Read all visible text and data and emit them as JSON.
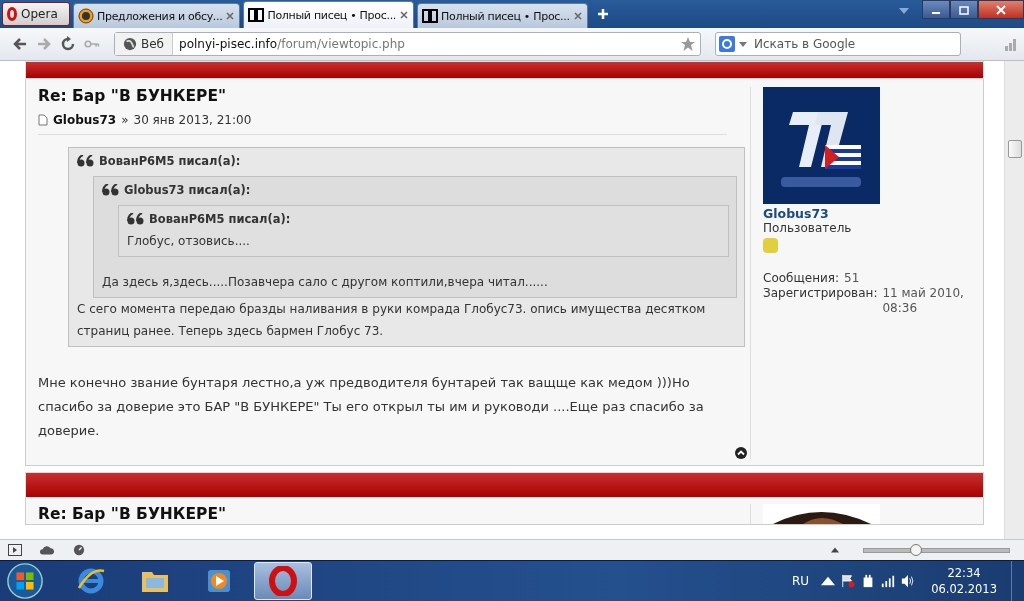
{
  "browser": {
    "menu_label": "Opera",
    "tabs": [
      {
        "label": "Предложения и обсу...",
        "selected": false,
        "kind": "globe"
      },
      {
        "label": "Полный писец • Прос...",
        "selected": true,
        "kind": "forum"
      },
      {
        "label": "Полный писец • Прос...",
        "selected": false,
        "kind": "forum"
      }
    ],
    "address": {
      "badge": "Веб",
      "host": "polnyi-pisec.info",
      "path": "/forum/viewtopic.php"
    },
    "search": {
      "placeholder": "Искать в Google"
    }
  },
  "post": {
    "title": "Re: Бар \"В БУНКЕРЕ\"",
    "author": "Globus73",
    "separator": "»",
    "date": "30 янв 2013, 21:00",
    "quote": {
      "header": "ВованР6М5 писал(а):",
      "text": "С сего момента передаю бразды наливания в руки комрада Глобус73. опись имущества десятком страниц ранее. Теперь здесь бармен Глобус 73.",
      "quote": {
        "header": "Globus73 писал(а):",
        "text": "Да здесь я,здесь.....Позавчера сало с другом коптили,вчера читал......",
        "quote": {
          "header": "ВованР6М5 писал(а):",
          "text": "Глобус, отзовись...."
        }
      }
    },
    "text": "Мне конечно звание бунтаря лестно,а уж предводителя бунтарей так ващще как медом )))Но спасибо за доверие это БАР \"В БУНКЕРЕ\" Ты его открыл ты им и руководи ....Еще раз спасибо за доверие.",
    "profile": {
      "username": "Globus73",
      "rank": "Пользователь",
      "stats": [
        {
          "label": "Сообщения:",
          "value": "51"
        },
        {
          "label": "Зарегистрирован:",
          "value": "11 май 2010, 08:36"
        }
      ]
    }
  },
  "next_post": {
    "title": "Re: Бар \"В БУНКЕРЕ\""
  },
  "status_bar": {
    "zoom": {
      "level": 0.35
    }
  },
  "taskbar": {
    "apps": [
      {
        "kind": "ie",
        "selected": false
      },
      {
        "kind": "folder",
        "selected": false
      },
      {
        "kind": "media",
        "selected": false
      },
      {
        "kind": "opera",
        "selected": true
      }
    ],
    "language": "RU",
    "time": "22:34",
    "date": "06.02.2013"
  }
}
